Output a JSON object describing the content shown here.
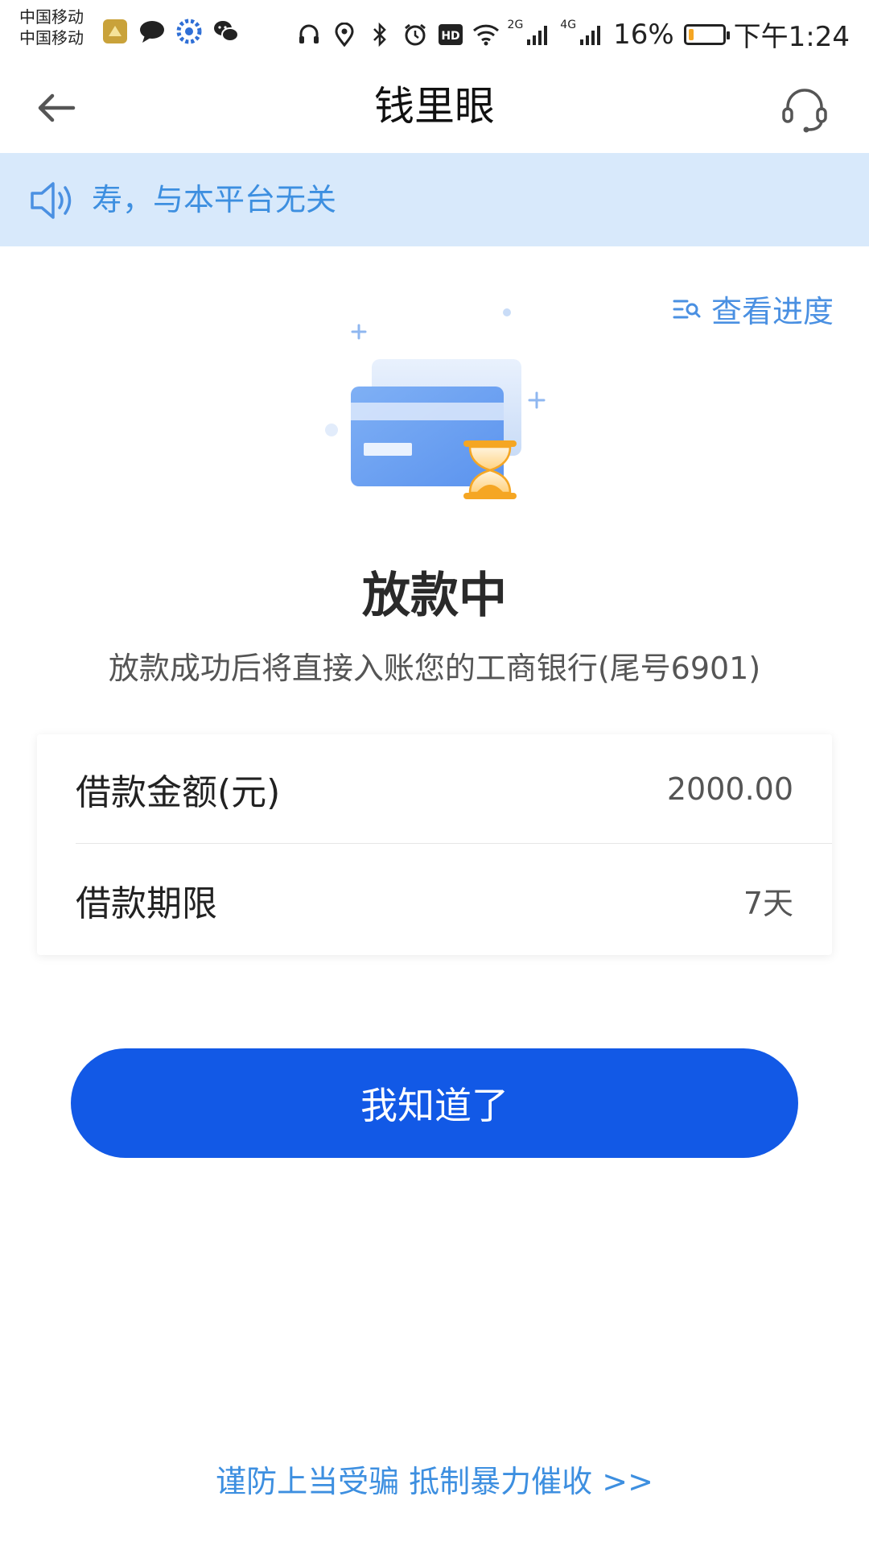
{
  "status_bar": {
    "carrier_1": "中国移动",
    "carrier_2": "中国移动",
    "network_1": "2G",
    "network_2": "4G",
    "battery_percent": "16%",
    "battery_level": 0.16,
    "time": "下午1:24",
    "hd_label": "HD"
  },
  "header": {
    "title": "钱里眼"
  },
  "notice": {
    "text": "寿，与本平台无关"
  },
  "progress_link": {
    "label": "查看进度"
  },
  "status": {
    "title": "放款中",
    "description": "放款成功后将直接入账您的工商银行(尾号6901)"
  },
  "loan_info": {
    "rows": [
      {
        "label": "借款金额(元)",
        "value": "2000.00"
      },
      {
        "label": "借款期限",
        "value": "7天"
      }
    ]
  },
  "confirm_button": {
    "label": "我知道了"
  },
  "footer": {
    "link_text": "谨防上当受骗 抵制暴力催收 >>"
  },
  "colors": {
    "primary": "#1259e6",
    "link_blue": "#3d8fe0",
    "notice_bg": "#d8e9fb",
    "hourglass_orange": "#f5a623"
  }
}
